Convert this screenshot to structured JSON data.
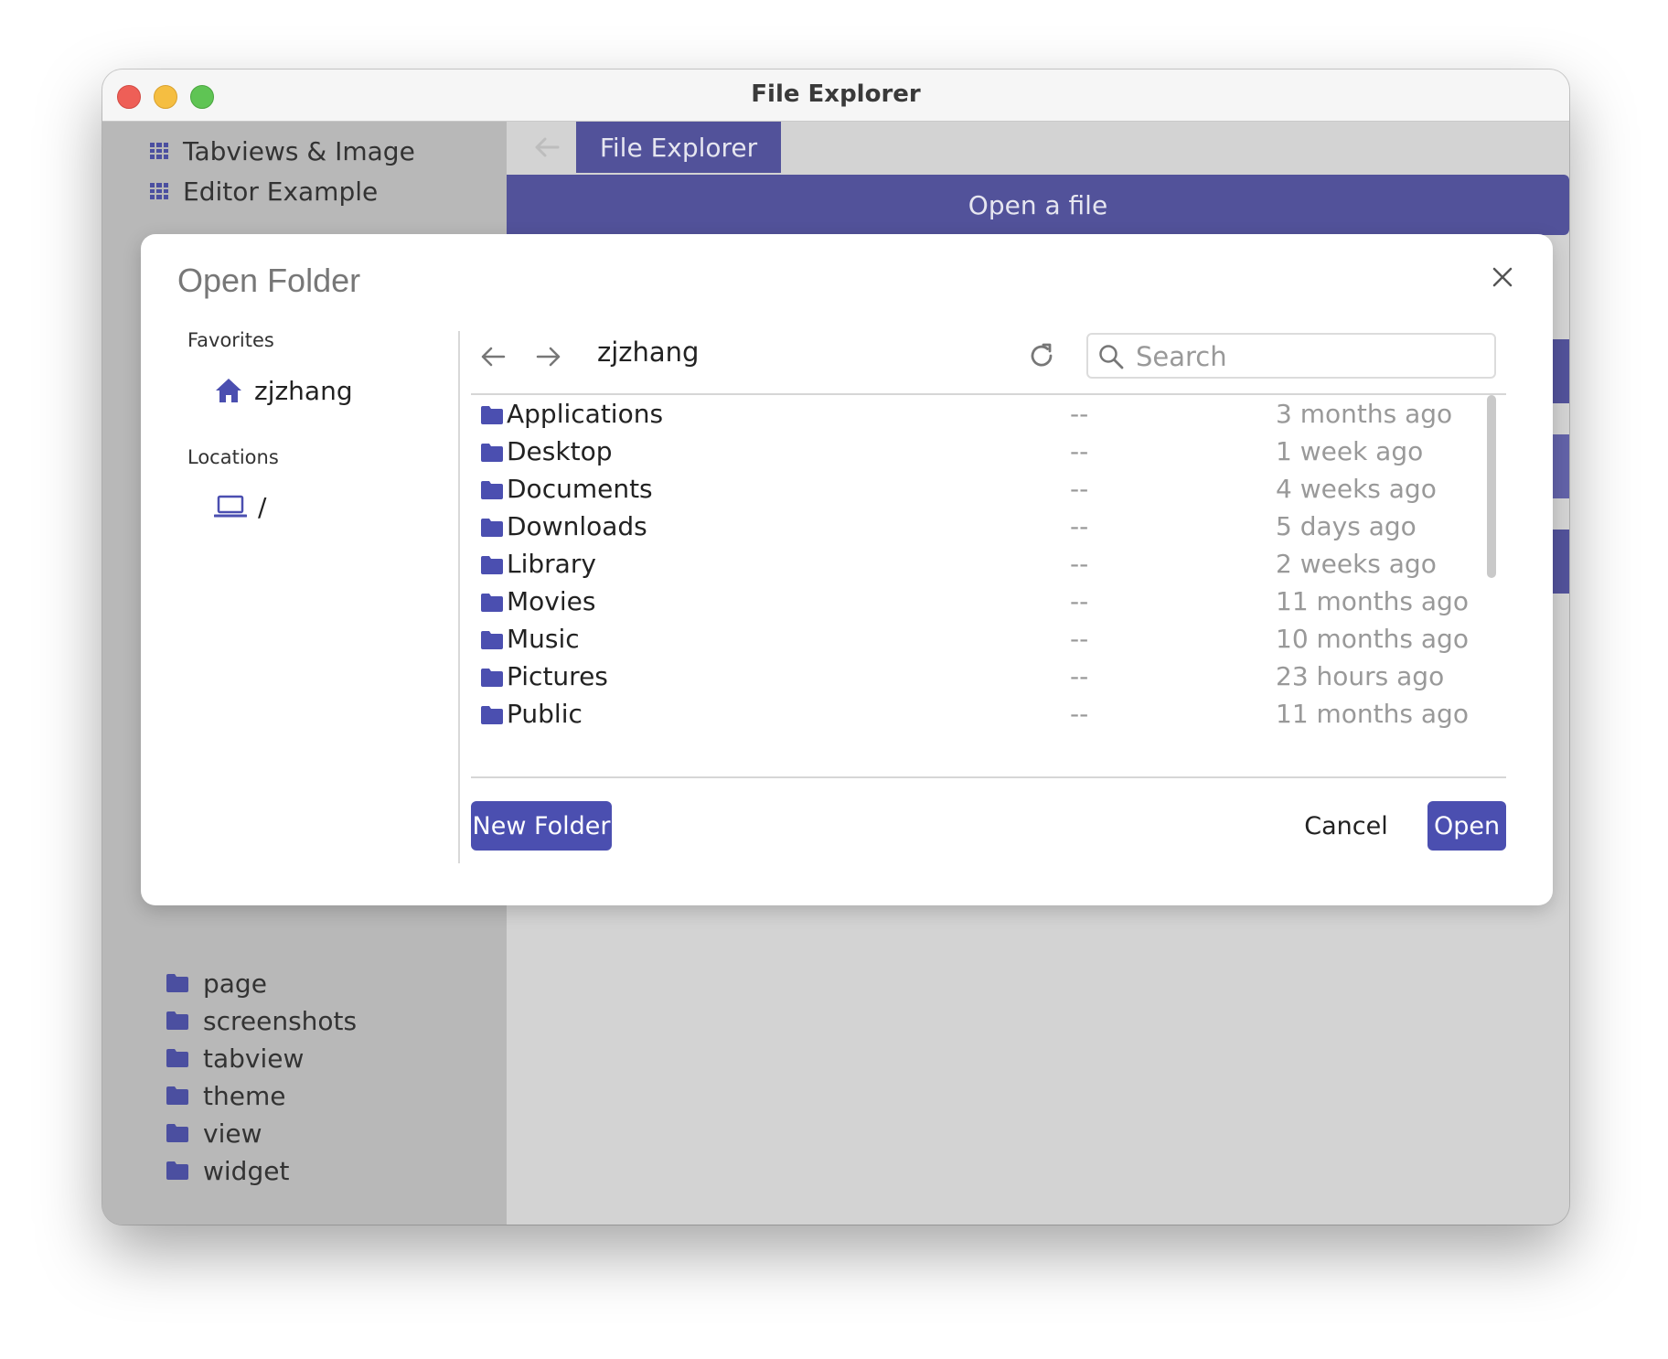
{
  "window": {
    "title": "File Explorer"
  },
  "sidebar": {
    "nav_items": [
      {
        "label": "Tabviews & Image"
      },
      {
        "label": "Editor Example"
      }
    ],
    "tree_items": [
      {
        "label": "page"
      },
      {
        "label": "screenshots"
      },
      {
        "label": "tabview"
      },
      {
        "label": "theme"
      },
      {
        "label": "view"
      },
      {
        "label": "widget"
      }
    ]
  },
  "main": {
    "tab_label": "File Explorer",
    "open_file_label": "Open a file"
  },
  "dialog": {
    "title": "Open Folder",
    "favorites_heading": "Favorites",
    "favorites": [
      {
        "label": "zjzhang",
        "icon": "home-icon"
      }
    ],
    "locations_heading": "Locations",
    "locations": [
      {
        "label": "/",
        "icon": "laptop-icon"
      }
    ],
    "current_path": "zjzhang",
    "search": {
      "placeholder": "Search",
      "value": ""
    },
    "files": [
      {
        "name": "Applications",
        "size": "--",
        "modified": "3 months ago"
      },
      {
        "name": "Desktop",
        "size": "--",
        "modified": "1 week ago"
      },
      {
        "name": "Documents",
        "size": "--",
        "modified": "4 weeks ago"
      },
      {
        "name": "Downloads",
        "size": "--",
        "modified": "5 days ago"
      },
      {
        "name": "Library",
        "size": "--",
        "modified": "2 weeks ago"
      },
      {
        "name": "Movies",
        "size": "--",
        "modified": "11 months ago"
      },
      {
        "name": "Music",
        "size": "--",
        "modified": "10 months ago"
      },
      {
        "name": "Pictures",
        "size": "--",
        "modified": "23 hours ago"
      },
      {
        "name": "Public",
        "size": "--",
        "modified": "11 months ago"
      }
    ],
    "buttons": {
      "new_folder": "New Folder",
      "cancel": "Cancel",
      "open": "Open"
    }
  },
  "colors": {
    "accent": "#4b4fb0",
    "header_bar": "#52529a",
    "sidebar_bg": "#b8b8b8",
    "main_bg": "#d3d3d3"
  }
}
